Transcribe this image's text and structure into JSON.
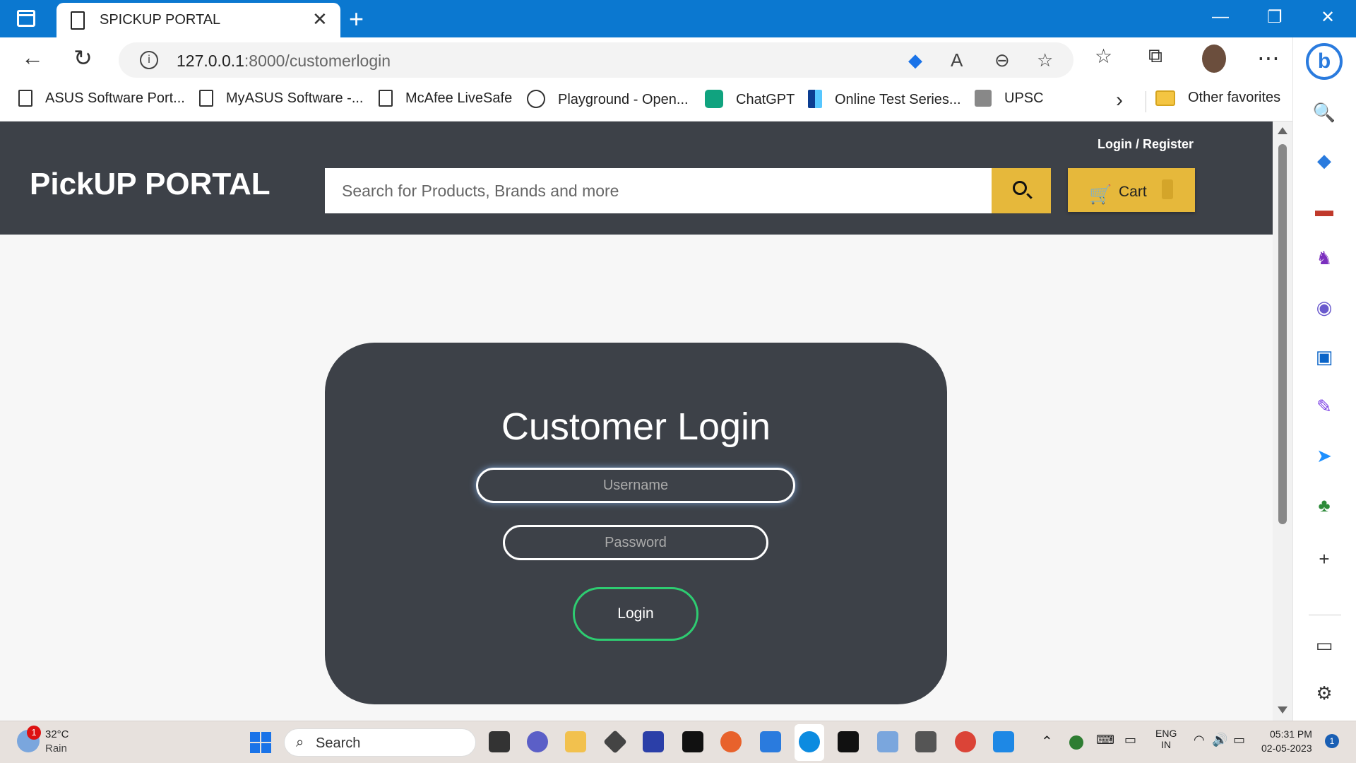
{
  "browser": {
    "tab_title": "SPICKUP PORTAL",
    "close_glyph": "✕",
    "new_tab_glyph": "+",
    "url_host": "127.0.0.1",
    "url_path": ":8000/customerlogin",
    "info_glyph": "i"
  },
  "favorites": {
    "items": [
      {
        "label": "ASUS Software Port...",
        "icon": "page-icon"
      },
      {
        "label": "MyASUS Software -...",
        "icon": "page-icon"
      },
      {
        "label": "McAfee LiveSafe",
        "icon": "page-icon"
      },
      {
        "label": "Playground - Open...",
        "icon": "openai-icon"
      },
      {
        "label": "ChatGPT",
        "icon": "chatgpt-icon"
      },
      {
        "label": "Online Test Series...",
        "icon": "test-series-icon"
      },
      {
        "label": "UPSC",
        "icon": "emblem-icon"
      }
    ],
    "other": "Other favorites"
  },
  "site": {
    "logo": "PickUP PORTAL",
    "login_register": "Login / Register",
    "search_placeholder": "Search for Products, Brands and more",
    "cart_label": "Cart"
  },
  "login": {
    "title": "Customer Login",
    "username_placeholder": "Username",
    "password_placeholder": "Password",
    "button_label": "Login"
  },
  "taskbar": {
    "weather_temp": "32°C",
    "weather_desc": "Rain",
    "weather_badge": "1",
    "search_label": "Search",
    "lang_top": "ENG",
    "lang_bottom": "IN",
    "time": "05:31 PM",
    "date": "02-05-2023",
    "notifications": "1"
  },
  "colors": {
    "header_bg": "#3d4148",
    "accent": "#e6b83b",
    "login_border": "#2ecc71",
    "titlebar": "#0b78d0"
  }
}
